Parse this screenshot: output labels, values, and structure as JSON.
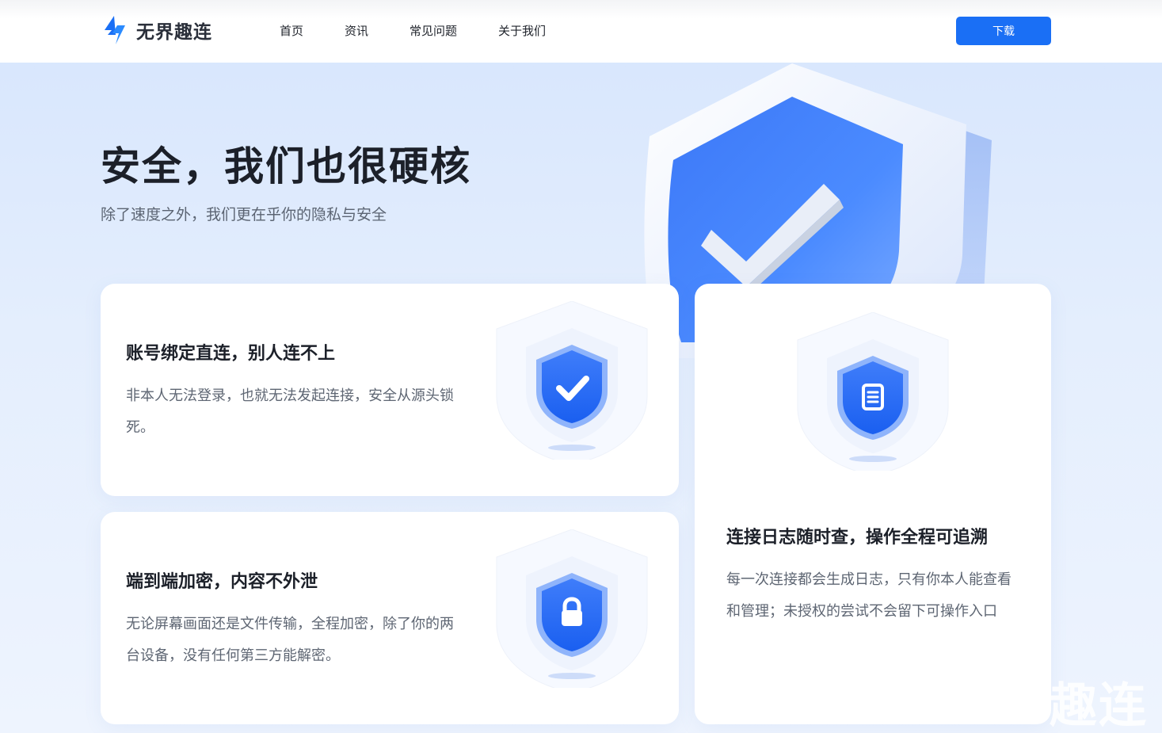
{
  "brand": {
    "name": "无界趣连",
    "accent": "#1a6ff5"
  },
  "nav": {
    "items": [
      "首页",
      "资讯",
      "常见问题",
      "关于我们"
    ]
  },
  "header": {
    "download_label": "下载"
  },
  "hero": {
    "title": "安全，我们也很硬核",
    "subtitle": "除了速度之外，我们更在乎你的隐私与安全"
  },
  "cards": [
    {
      "title": "账号绑定直连，别人连不上",
      "desc": "非本人无法登录，也就无法发起连接，安全从源头锁死。",
      "icon": "shield-check-icon"
    },
    {
      "title": "端到端加密，内容不外泄",
      "desc": "无论屏幕画面还是文件传输，全程加密，除了你的两台设备，没有任何第三方能解密。",
      "icon": "shield-lock-icon"
    },
    {
      "title": "连接日志随时查，操作全程可追溯",
      "desc": "每一次连接都会生成日志，只有你本人能查看和管理；未授权的尝试不会留下可操作入口",
      "icon": "shield-document-icon"
    }
  ],
  "watermark": "趣连"
}
